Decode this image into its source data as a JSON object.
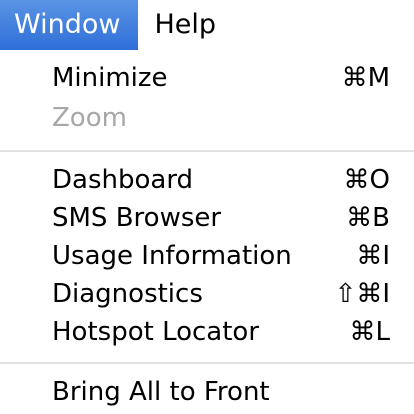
{
  "menubar": {
    "window_label": "Window",
    "help_label": "Help",
    "active_color": "#3a78dc"
  },
  "menu": {
    "items": [
      {
        "label": "Minimize",
        "shortcut": "⌘M",
        "enabled": true
      },
      {
        "label": "Zoom",
        "shortcut": "",
        "enabled": false
      },
      {
        "label": "Dashboard",
        "shortcut": "⌘O",
        "enabled": true
      },
      {
        "label": "SMS Browser",
        "shortcut": "⌘B",
        "enabled": true
      },
      {
        "label": "Usage Information",
        "shortcut": "⌘I",
        "enabled": true
      },
      {
        "label": "Diagnostics",
        "shortcut": "⇧⌘I",
        "enabled": true
      },
      {
        "label": "Hotspot Locator",
        "shortcut": "⌘L",
        "enabled": true
      },
      {
        "label": "Bring All to Front",
        "shortcut": "",
        "enabled": true
      }
    ]
  }
}
